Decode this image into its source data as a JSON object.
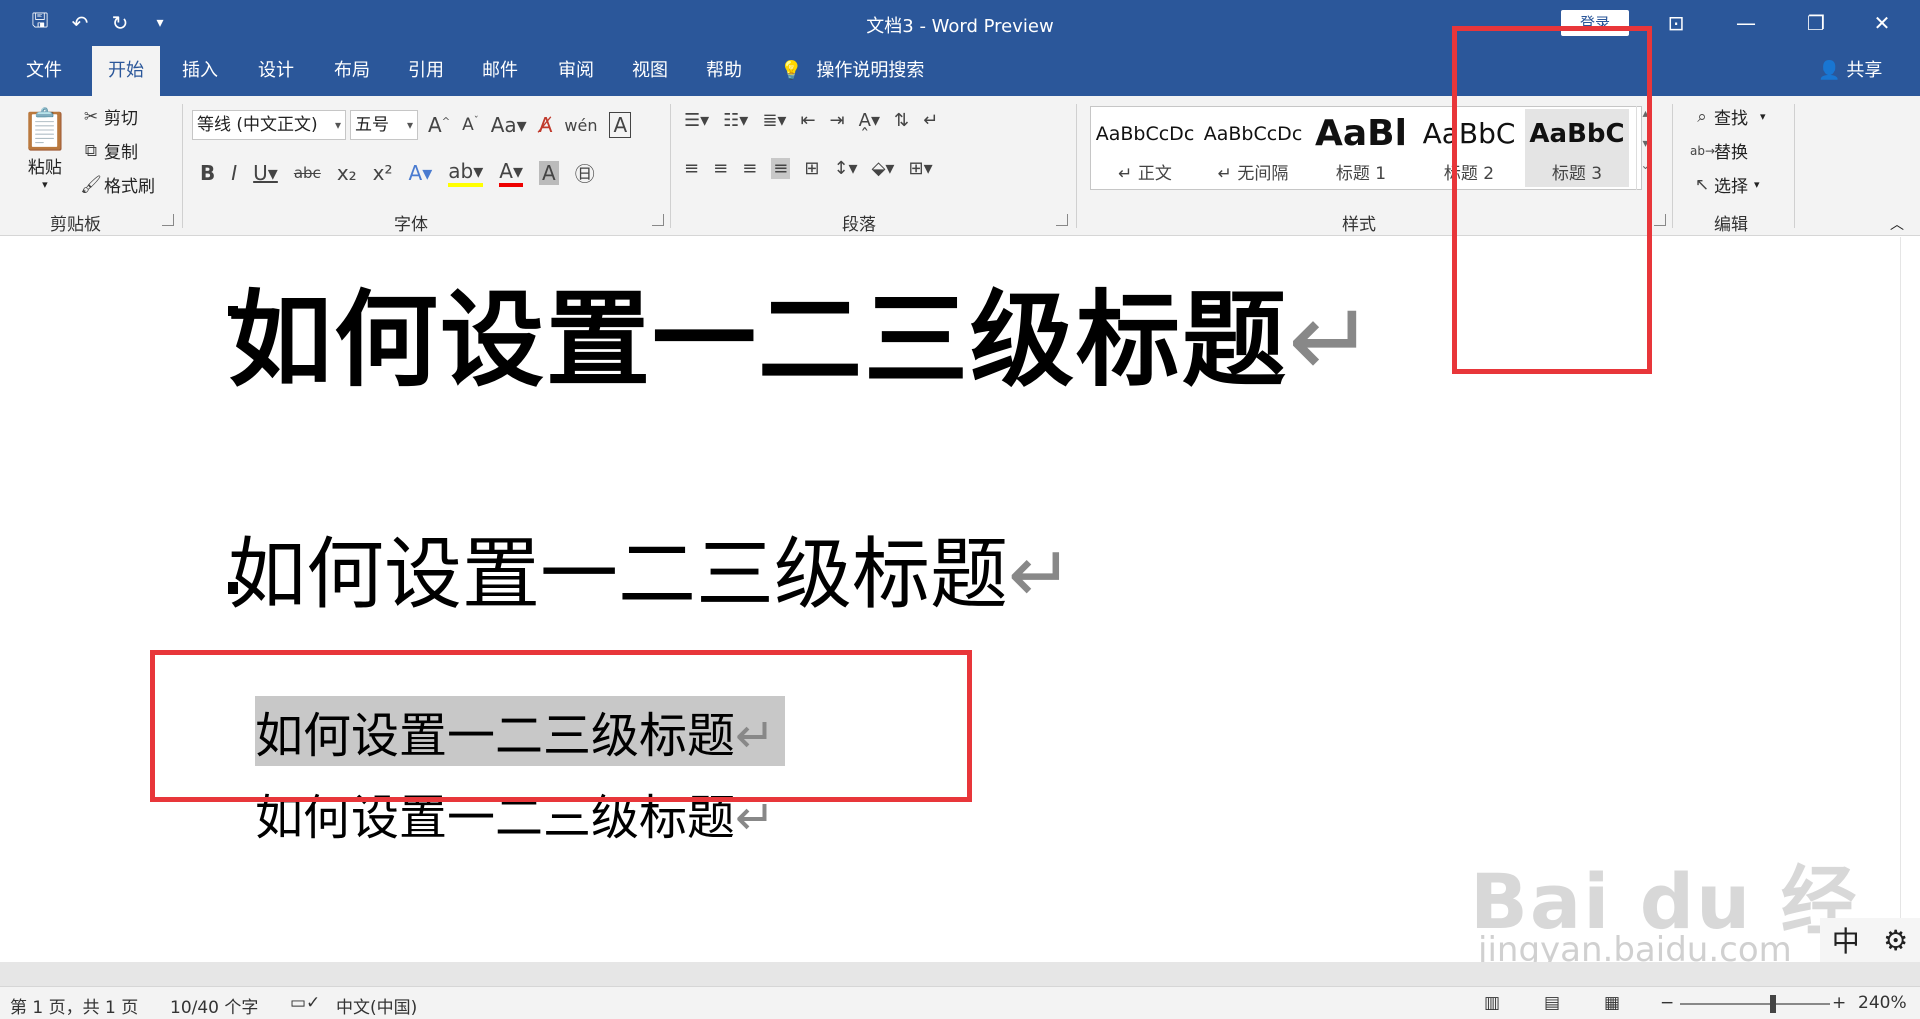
{
  "window": {
    "title": "文档3  -  Word Preview",
    "login": "登录"
  },
  "tabs": [
    "文件",
    "开始",
    "插入",
    "设计",
    "布局",
    "引用",
    "邮件",
    "审阅",
    "视图",
    "帮助"
  ],
  "tell_me": "操作说明搜索",
  "share": "共享",
  "clipboard": {
    "paste": "粘贴",
    "cut": "剪切",
    "copy": "复制",
    "format_painter": "格式刷",
    "label": "剪贴板"
  },
  "font": {
    "name": "等线 (中文正文)",
    "size": "五号",
    "label": "字体"
  },
  "paragraph": {
    "label": "段落"
  },
  "styles": {
    "label": "样式",
    "items": [
      {
        "sample": "AaBbCcDc",
        "name": "↵ 正文"
      },
      {
        "sample": "AaBbCcDc",
        "name": "↵ 无间隔"
      },
      {
        "sample": "AaBl",
        "name": "标题 1"
      },
      {
        "sample": "AaBbC",
        "name": "标题 2"
      },
      {
        "sample": "AaBbC",
        "name": "标题 3"
      }
    ]
  },
  "editing": {
    "find": "查找",
    "replace": "替换",
    "select": "选择",
    "label": "编辑"
  },
  "document": {
    "lines": [
      "如何设置一二三级标题",
      "如何设置一二三级标题",
      "如何设置一二三级标题",
      "如何设置一二三级标题"
    ],
    "para_mark": "↵"
  },
  "ime": {
    "mode": "中"
  },
  "watermark": {
    "brand": "Bai du 经验",
    "url": "jingyan.baidu.com"
  },
  "status": {
    "page": "第 1 页，共 1 页",
    "words": "10/40 个字",
    "language": "中文(中国)",
    "zoom": "240%"
  }
}
